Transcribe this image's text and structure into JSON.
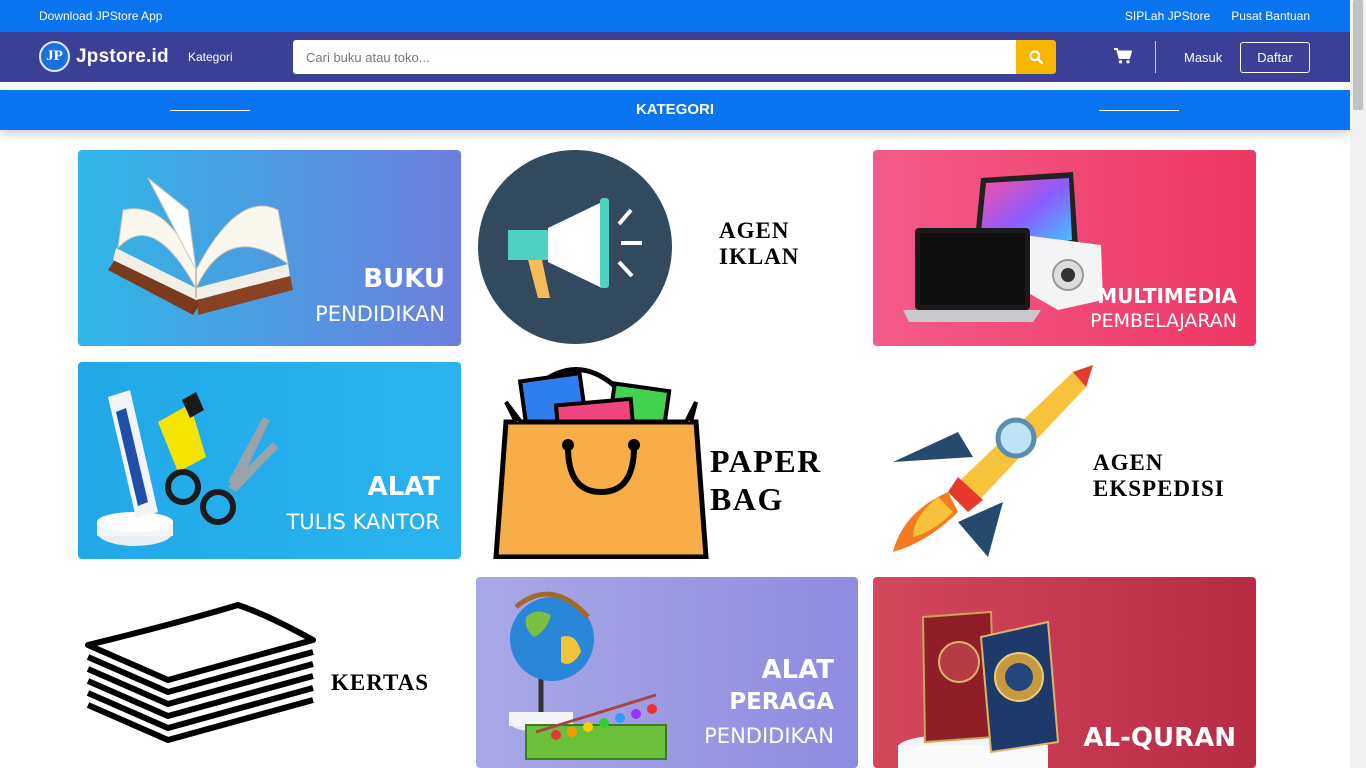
{
  "topbar": {
    "download_app": "Download JPStore App",
    "siplah": "SIPLah JPStore",
    "help": "Pusat Bantuan"
  },
  "navbar": {
    "logo_mark": "JP",
    "logo_text": "Jpstore.id",
    "kategori": "Kategori",
    "search_placeholder": "Cari buku atau toko...",
    "login": "Masuk",
    "register": "Daftar"
  },
  "category_bar": {
    "title": "KATEGORI"
  },
  "categories": [
    {
      "line1": "BUKU",
      "line2": "PENDIDIKAN",
      "icon": "open-book"
    },
    {
      "line1": "AGEN",
      "line2": "IKLAN",
      "icon": "megaphone"
    },
    {
      "line1": "MULTIMEDIA",
      "line2": "PEMBELAJARAN",
      "icon": "laptop-projector"
    },
    {
      "line1": "ALAT",
      "line2": "TULIS KANTOR",
      "icon": "stationery"
    },
    {
      "line1": "PAPER",
      "line2": "BAG",
      "icon": "shopping-bag"
    },
    {
      "line1": "AGEN",
      "line2": "EKSPEDISI",
      "icon": "rocket"
    },
    {
      "line1": "KERTAS",
      "icon": "paper-stack"
    },
    {
      "line1": "ALAT",
      "line2": "PERAGA",
      "line3": "PENDIDIKAN",
      "icon": "globe-abacus"
    },
    {
      "line1": "AL-QURAN",
      "icon": "quran-books"
    }
  ],
  "colors": {
    "topbar": "#0a73f0",
    "navbar": "#3b3f96",
    "search_button": "#f7b500"
  }
}
